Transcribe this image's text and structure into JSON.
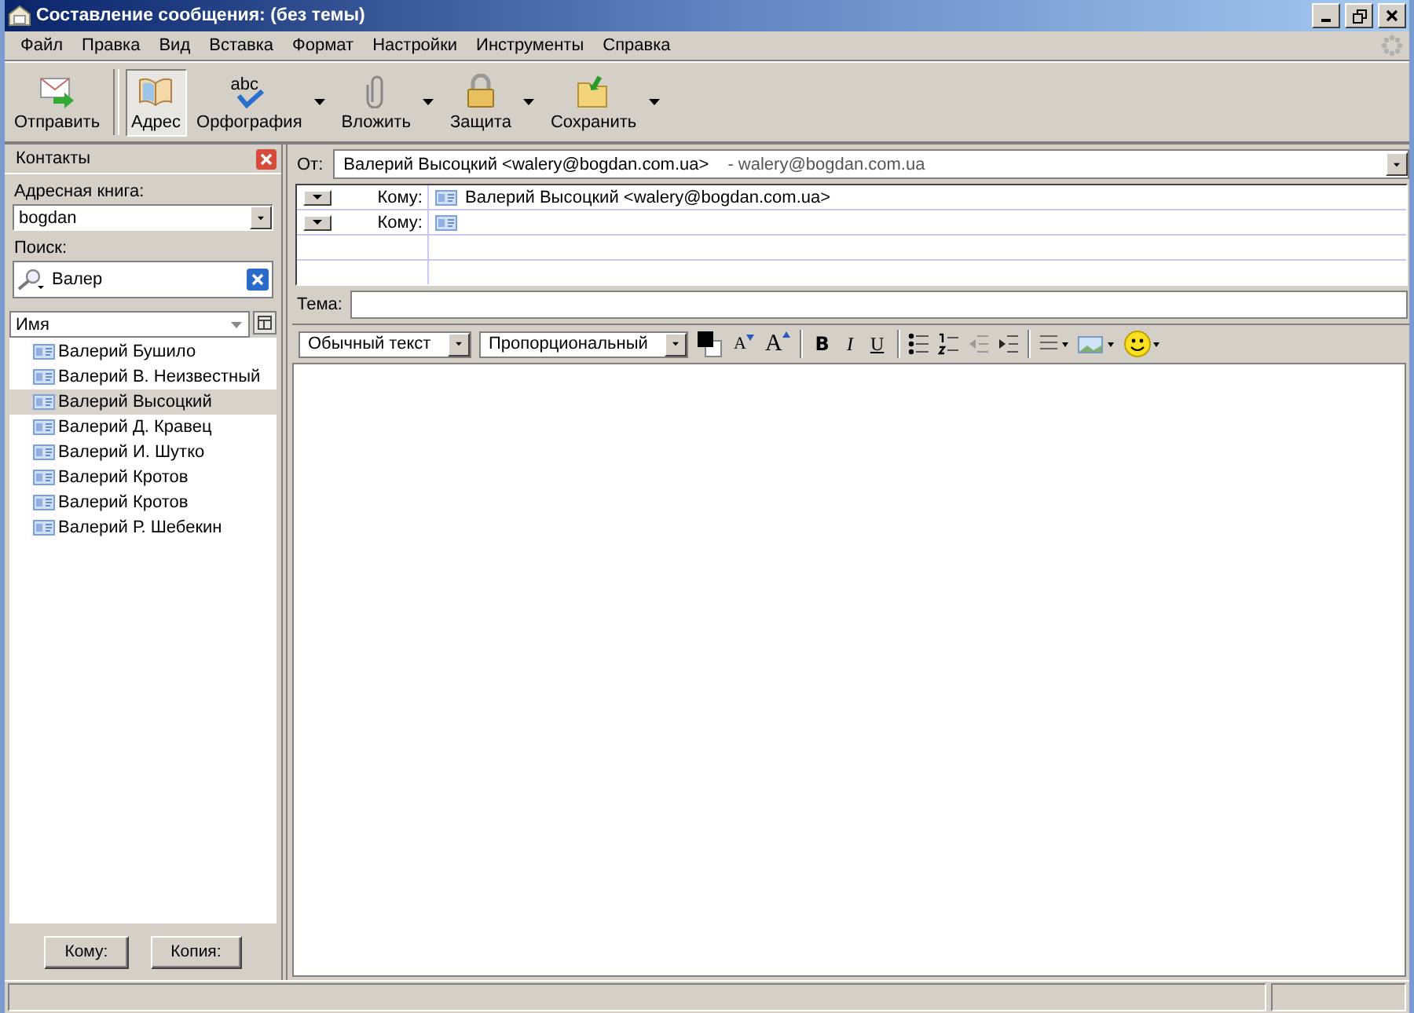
{
  "window": {
    "title": "Составление сообщения: (без темы)"
  },
  "menu": [
    "Файл",
    "Правка",
    "Вид",
    "Вставка",
    "Формат",
    "Настройки",
    "Инструменты",
    "Справка"
  ],
  "toolbar": [
    {
      "kind": "send",
      "label": "Отправить",
      "dropdown": false,
      "selected": false
    },
    {
      "kind": "address",
      "label": "Адрес",
      "dropdown": false,
      "selected": true
    },
    {
      "kind": "spelling",
      "label": "Орфография",
      "icon_text": "abc",
      "dropdown": true,
      "selected": false
    },
    {
      "kind": "attach",
      "label": "Вложить",
      "dropdown": true,
      "selected": false
    },
    {
      "kind": "security",
      "label": "Защита",
      "dropdown": true,
      "selected": false
    },
    {
      "kind": "save",
      "label": "Сохранить",
      "dropdown": true,
      "selected": false
    }
  ],
  "contacts_panel": {
    "title": "Контакты",
    "address_book_label": "Адресная книга:",
    "address_book": "bogdan",
    "search_label": "Поиск:",
    "search": "Валер",
    "column": "Имя",
    "contacts": [
      {
        "name": "Валерий Бушило",
        "selected": false
      },
      {
        "name": "Валерий В. Неизвестный",
        "selected": false
      },
      {
        "name": "Валерий Высоцкий",
        "selected": true
      },
      {
        "name": "Валерий Д. Кравец",
        "selected": false
      },
      {
        "name": "Валерий И. Шутко",
        "selected": false
      },
      {
        "name": "Валерий Кротов",
        "selected": false
      },
      {
        "name": "Валерий Кротов",
        "selected": false
      },
      {
        "name": "Валерий Р. Шебекин",
        "selected": false
      }
    ],
    "buttons": [
      "Кому:",
      "Копия:"
    ]
  },
  "header": {
    "from_label": "От:",
    "from": "Валерий Высоцкий <walery@bogdan.com.ua>",
    "from_hint": "- walery@bogdan.com.ua",
    "recipients": [
      {
        "type": "Кому:",
        "address": "Валерий Высоцкий <walery@bogdan.com.ua>"
      },
      {
        "type": "Кому:"
      }
    ],
    "subject_label": "Тема:"
  },
  "format_toolbar": {
    "paragraph": "Обычный текст",
    "font": "Пропорциональный",
    "decrease_font": "A",
    "increase_font": "A",
    "bold": "B",
    "italic": "I",
    "underline": "U"
  }
}
